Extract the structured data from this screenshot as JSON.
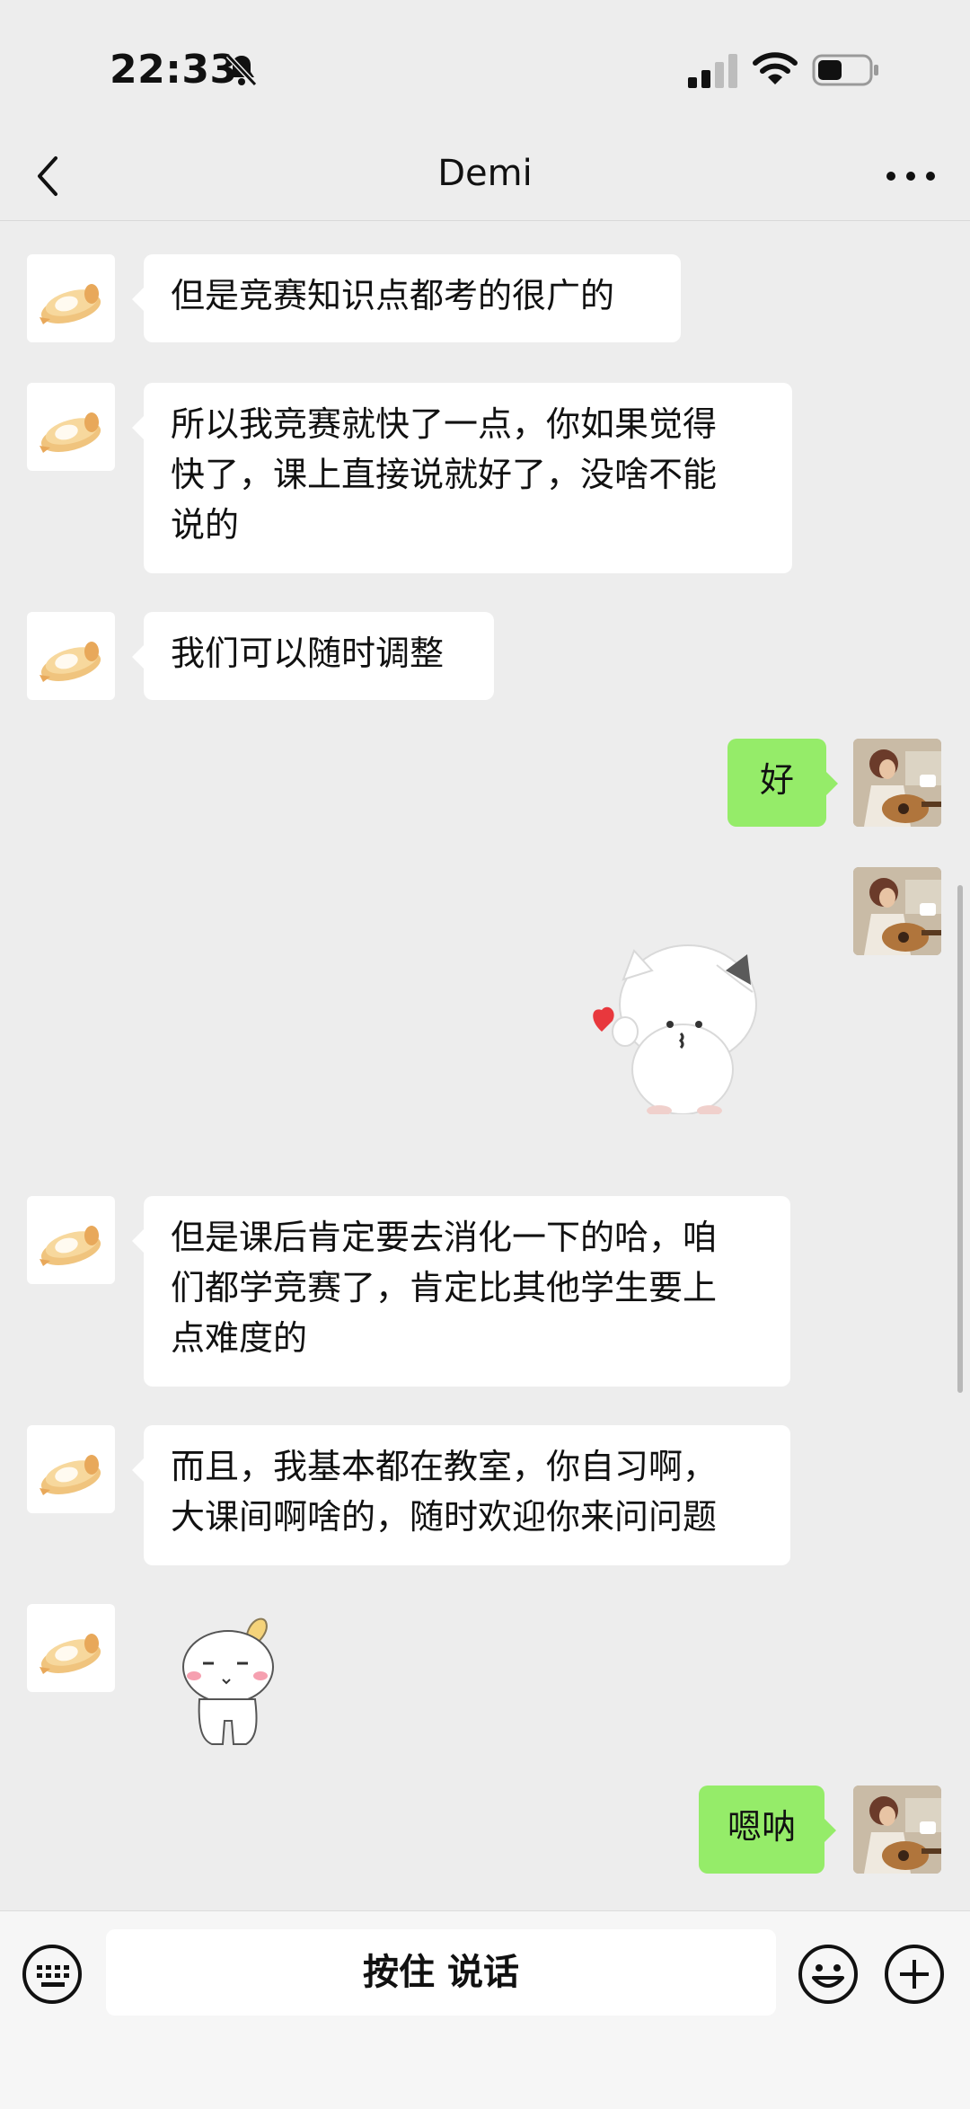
{
  "status_bar": {
    "time": "22:33",
    "icons": [
      "bell-muted-icon",
      "cellular-signal-icon",
      "wifi-icon",
      "battery-icon"
    ]
  },
  "header": {
    "title": "Demi",
    "back_icon": "chevron-left-icon",
    "more_icon": "more-dots-icon"
  },
  "messages": [
    {
      "side": "left",
      "type": "text",
      "text": "但是竞赛知识点都考的很广的"
    },
    {
      "side": "left",
      "type": "text",
      "lines": [
        "所以我竞赛就快了一点，你如果觉得",
        "快了，课上直接说就好了，没啥不能",
        "说的"
      ]
    },
    {
      "side": "left",
      "type": "text",
      "text": "我们可以随时调整"
    },
    {
      "side": "right",
      "type": "text",
      "text": "好"
    },
    {
      "side": "right",
      "type": "sticker",
      "sticker": "cat-blowing-kiss-heart-sticker"
    },
    {
      "side": "left",
      "type": "text",
      "lines": [
        "但是课后肯定要去消化一下的哈，咱",
        "们都学竞赛了，肯定比其他学生要上",
        "点难度的"
      ]
    },
    {
      "side": "left",
      "type": "text",
      "lines": [
        "而且，我基本都在教室，你自习啊，",
        "大课间啊啥的，随时欢迎你来问问题"
      ]
    },
    {
      "side": "left",
      "type": "sticker",
      "sticker": "white-bunny-blushing-sticker"
    },
    {
      "side": "right",
      "type": "text",
      "text": "嗯呐"
    }
  ],
  "input_bar": {
    "hold_to_talk": "按住 说话",
    "icons": [
      "keyboard-icon",
      "emoji-icon",
      "plus-icon"
    ]
  },
  "colors": {
    "background": "#ededed",
    "bubble_received": "#ffffff",
    "bubble_sent": "#95ec69"
  }
}
